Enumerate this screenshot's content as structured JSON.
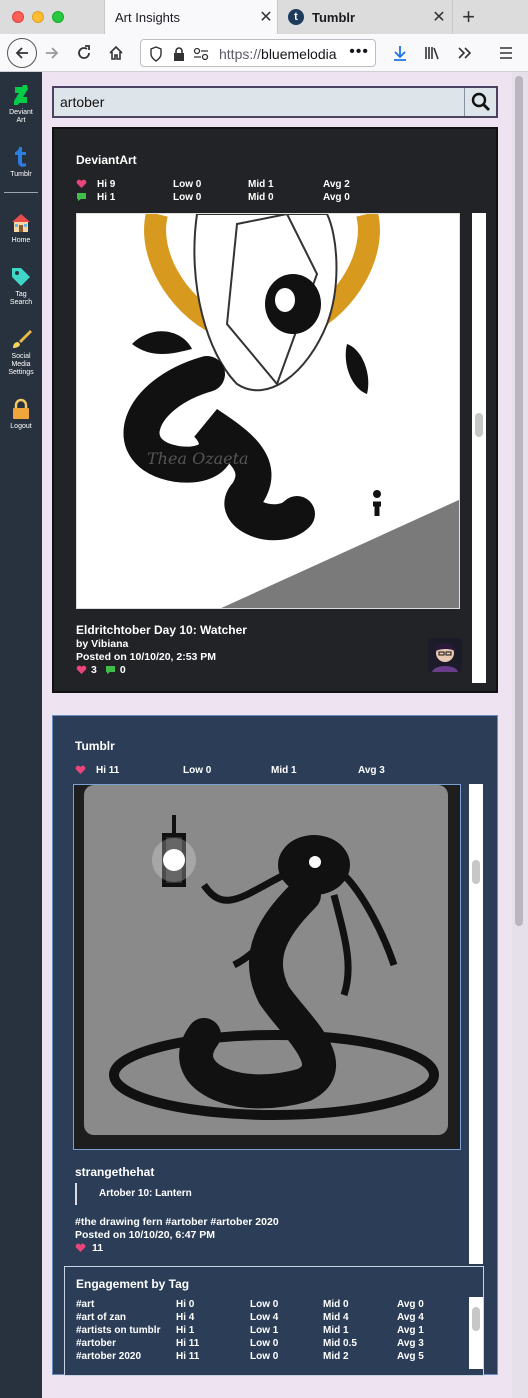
{
  "browser": {
    "tabs": [
      {
        "label": "Art Insights",
        "active": true
      },
      {
        "label": "Tumblr",
        "active": false
      }
    ],
    "url_scheme": "https://",
    "url_host": "bluemelodia"
  },
  "sidebar": {
    "items": [
      {
        "label_line1": "Deviant",
        "label_line2": "Art",
        "icon": "deviantart-icon"
      },
      {
        "label_line1": "Tumblr",
        "label_line2": "",
        "icon": "tumblr-icon"
      },
      {
        "label_line1": "Home",
        "label_line2": "",
        "icon": "home-icon"
      },
      {
        "label_line1": "Tag",
        "label_line2": "Search",
        "icon": "tag-icon"
      },
      {
        "label_line1": "Social",
        "label_line2": "Media",
        "label_line3": "Settings",
        "icon": "settings-brush-icon"
      },
      {
        "label_line1": "Logout",
        "label_line2": "",
        "icon": "lock-icon"
      }
    ]
  },
  "search": {
    "value": "artober",
    "button_icon": "search-icon"
  },
  "deviantart": {
    "title": "DeviantArt",
    "favs": {
      "hi": "Hi 9",
      "low": "Low 0",
      "mid": "Mid 1",
      "avg": "Avg 2"
    },
    "comments": {
      "hi": "Hi 1",
      "low": "Low 0",
      "mid": "Mid 0",
      "avg": "Avg 0"
    },
    "post": {
      "title": "Eldritchtober Day 10: Watcher",
      "by": "by Vibiana",
      "posted": "Posted on 10/10/20, 2:53 PM",
      "fav_count": "3",
      "comment_count": "0",
      "signature": "Thea Ozaeta"
    }
  },
  "tumblr": {
    "title": "Tumblr",
    "notes": {
      "hi": "Hi 11",
      "low": "Low 0",
      "mid": "Mid 1",
      "avg": "Avg 3"
    },
    "post": {
      "author": "strangethehat",
      "quote": "Artober 10: Lantern",
      "tags": "#the drawing fern #artober #artober 2020",
      "posted": "Posted on 10/10/20, 6:47 PM",
      "note_count": "11"
    }
  },
  "engagement": {
    "title": "Engagement by Tag",
    "rows": [
      {
        "tag": "#art",
        "hi": "Hi 0",
        "low": "Low 0",
        "mid": "Mid 0",
        "avg": "Avg 0"
      },
      {
        "tag": "#art of zan",
        "hi": "Hi 4",
        "low": "Low 4",
        "mid": "Mid 4",
        "avg": "Avg 4"
      },
      {
        "tag": "#artists on tumblr",
        "hi": "Hi 1",
        "low": "Low 1",
        "mid": "Mid 1",
        "avg": "Avg 1"
      },
      {
        "tag": "#artober",
        "hi": "Hi 11",
        "low": "Low 0",
        "mid": "Mid 0.5",
        "avg": "Avg 3"
      },
      {
        "tag": "#artober 2020",
        "hi": "Hi 11",
        "low": "Low 0",
        "mid": "Mid 2",
        "avg": "Avg 5"
      }
    ]
  },
  "colors": {
    "heart": "#e8457a",
    "comment": "#3fbf4a",
    "deviantart_green": "#05cc47",
    "tumblr_blue": "#2b7de0",
    "card_dark": "#222326",
    "card_tumblr": "#2c3e57"
  }
}
